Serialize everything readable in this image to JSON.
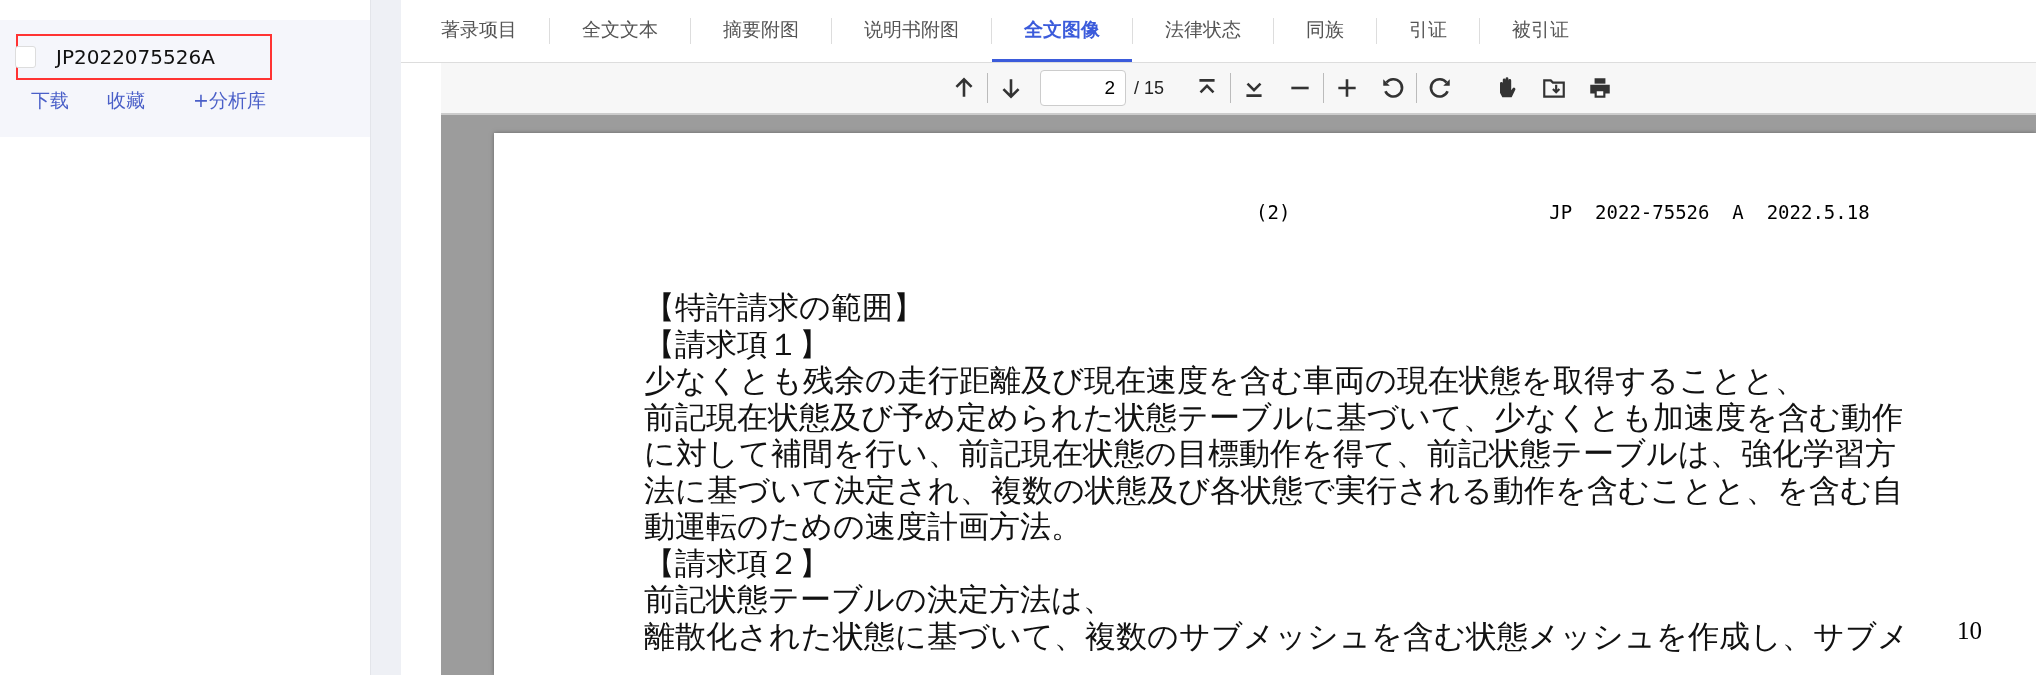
{
  "result_item": {
    "checked": false,
    "number": "JP2022075526A",
    "highlighted": true,
    "actions": [
      "下载",
      "收藏",
      "+分析库"
    ]
  },
  "tabs": [
    {
      "label": "著录项目",
      "selected": false
    },
    {
      "label": "全文文本",
      "selected": false
    },
    {
      "label": "摘要附图",
      "selected": false
    },
    {
      "label": "说明书附图",
      "selected": false
    },
    {
      "label": "全文图像",
      "selected": true
    },
    {
      "label": "法律状态",
      "selected": false
    },
    {
      "label": "同族",
      "selected": false
    },
    {
      "label": "引证",
      "selected": false
    },
    {
      "label": "被引证",
      "selected": false
    }
  ],
  "viewer_toolbar": {
    "page": "2",
    "page_count": "/ 15"
  },
  "document_page": {
    "page_label": "(2)",
    "header": "JP  2022-75526  A  2022.5.18",
    "lines": [
      "【特許請求の範囲】",
      "【請求項１】",
      "少なくとも残余の走行距離及び現在速度を含む車両の現在状態を取得することと、",
      "前記現在状態及び予め定められた状態テーブルに基づいて、少なくとも加速度を含む動作",
      "に対して補間を行い、前記現在状態の目標動作を得て、前記状態テーブルは、強化学習方",
      "法に基づいて決定され、複数の状態及び各状態で実行される動作を含むことと、を含む自",
      "動運転のための速度計画方法。",
      "【請求項２】",
      "前記状態テーブルの決定方法は、",
      "離散化された状態に基づいて、複数のサブメッシュを含む状態メッシュを作成し、サブメ"
    ],
    "line_number": "10"
  }
}
